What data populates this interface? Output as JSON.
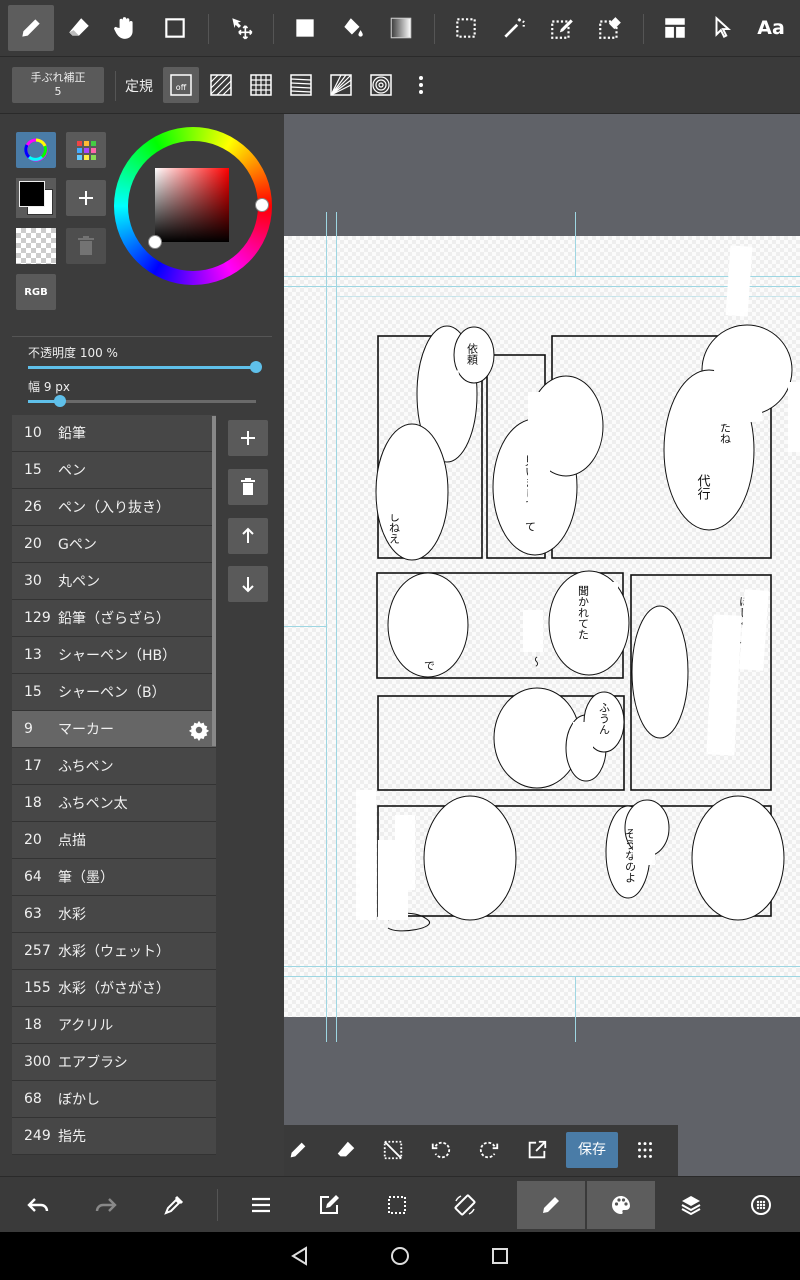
{
  "toolbar": {
    "tools": [
      "pen-tool",
      "eraser-tool",
      "hand-tool",
      "shape-tool",
      "move-tool",
      "fill-rect-tool",
      "bucket-tool",
      "gradient-tool",
      "select-tool",
      "magic-wand-tool",
      "select-pen-tool",
      "select-eraser-tool",
      "frame-divide-tool",
      "operation-tool",
      "text-tool"
    ],
    "text_tool_label": "Aa"
  },
  "subbar": {
    "stabilizer_label": "手ぶれ補正",
    "stabilizer_value": "5",
    "ruler_label": "定規",
    "ruler_off_label": "off"
  },
  "color_panel": {
    "rgb_label": "RGB",
    "opacity_label": "不透明度 100 %",
    "opacity_value": 1.0,
    "width_label": "幅 9 px",
    "width_value": 0.14,
    "hue_color": "#ff0000",
    "foreground_color": "#000000",
    "background_color": "#ffffff"
  },
  "brushes": [
    {
      "size": "10",
      "name": "鉛筆"
    },
    {
      "size": "15",
      "name": "ペン"
    },
    {
      "size": "26",
      "name": "ペン（入り抜き）"
    },
    {
      "size": "20",
      "name": "Gペン"
    },
    {
      "size": "30",
      "name": "丸ペン"
    },
    {
      "size": "129",
      "name": "鉛筆（ざらざら）"
    },
    {
      "size": "13",
      "name": "シャーペン（HB）"
    },
    {
      "size": "15",
      "name": "シャーペン（B）"
    },
    {
      "size": "9",
      "name": "マーカー",
      "selected": true
    },
    {
      "size": "17",
      "name": "ふちペン"
    },
    {
      "size": "18",
      "name": "ふちペン太"
    },
    {
      "size": "20",
      "name": "点描"
    },
    {
      "size": "64",
      "name": "筆（墨）"
    },
    {
      "size": "63",
      "name": "水彩"
    },
    {
      "size": "257",
      "name": "水彩（ウェット）"
    },
    {
      "size": "155",
      "name": "水彩（がさがさ）"
    },
    {
      "size": "18",
      "name": "アクリル"
    },
    {
      "size": "300",
      "name": "エアブラシ"
    },
    {
      "size": "68",
      "name": "ぼかし"
    },
    {
      "size": "249",
      "name": "指先"
    }
  ],
  "canvas": {
    "texts": {
      "t1": "依頼",
      "t2": "いしねえ",
      "t3": "見いましすって",
      "t4": "たね",
      "t5": "代行",
      "t6": "で",
      "t7": "〜",
      "t8": "聞かれてた",
      "t9": "ほしくって？",
      "t10": "ふうん",
      "t11": "そうなのよ"
    }
  },
  "bottom_tools": {
    "save_label": "保存"
  }
}
